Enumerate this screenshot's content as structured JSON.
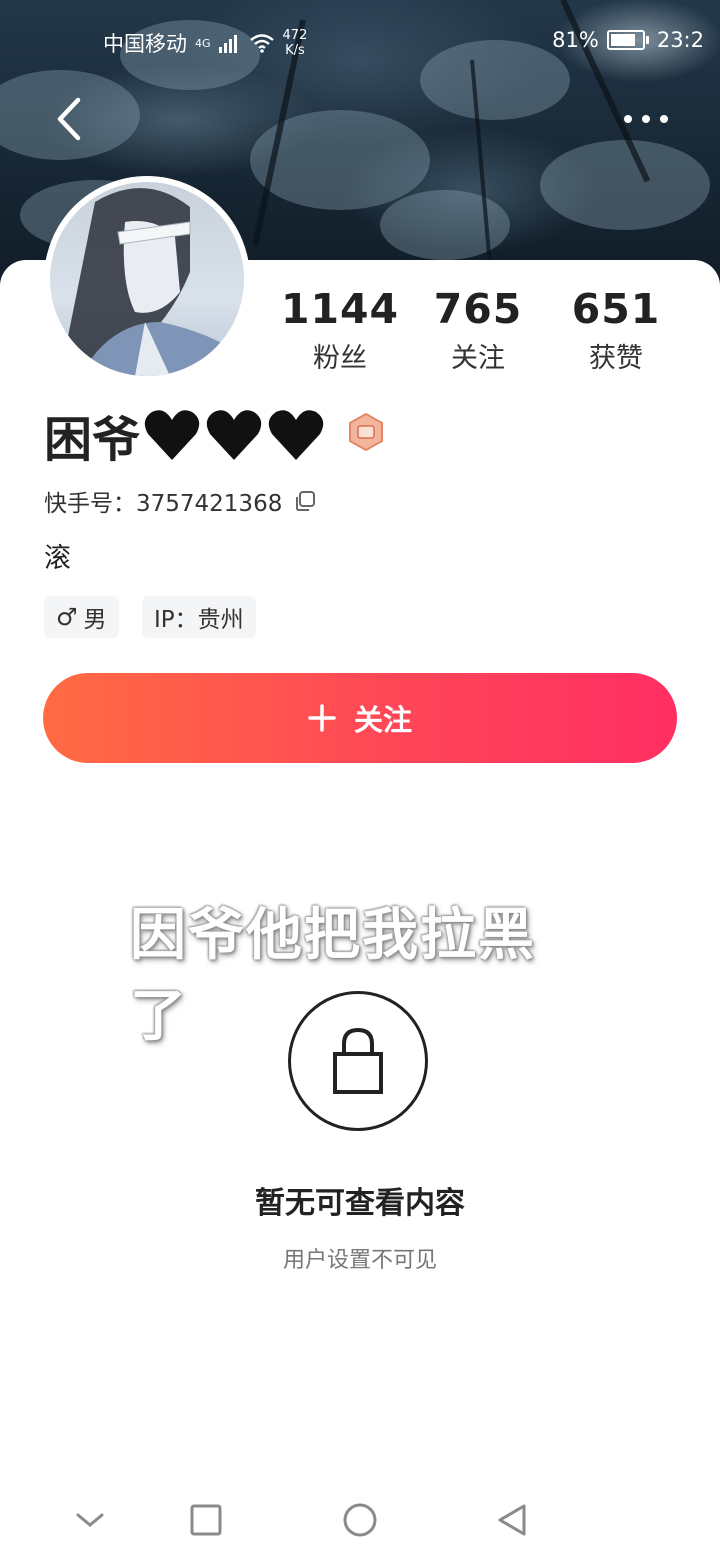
{
  "status_bar": {
    "carrier": "中国移动",
    "network": "4G",
    "speed_value": "472",
    "speed_unit": "K/s",
    "battery": "81%",
    "time": "23:2"
  },
  "header": {
    "back_icon": "chevron-left-icon",
    "more_icon": "more-dots-icon"
  },
  "profile": {
    "name": "困爷",
    "hearts": [
      "🖤",
      "🖤",
      "🖤"
    ],
    "id_label": "快手号：3757421368",
    "bio": "滚",
    "gender_symbol": "♂",
    "gender": "男",
    "ip": "IP：贵州"
  },
  "stats": [
    {
      "value": "1144",
      "label": "粉丝"
    },
    {
      "value": "765",
      "label": "关注"
    },
    {
      "value": "651",
      "label": "获赞"
    }
  ],
  "follow_button": {
    "icon": "+",
    "label": "关注"
  },
  "overlay_caption": "因爷他把我拉黑了",
  "empty_state": {
    "icon": "lock-icon",
    "title": "暂无可查看内容",
    "subtitle": "用户设置不可见"
  },
  "nav": [
    "chevron-down-icon",
    "square-icon",
    "circle-icon",
    "triangle-back-icon"
  ],
  "colors": {
    "follow_start": "#ff6b43",
    "follow_end": "#ff2e63"
  }
}
